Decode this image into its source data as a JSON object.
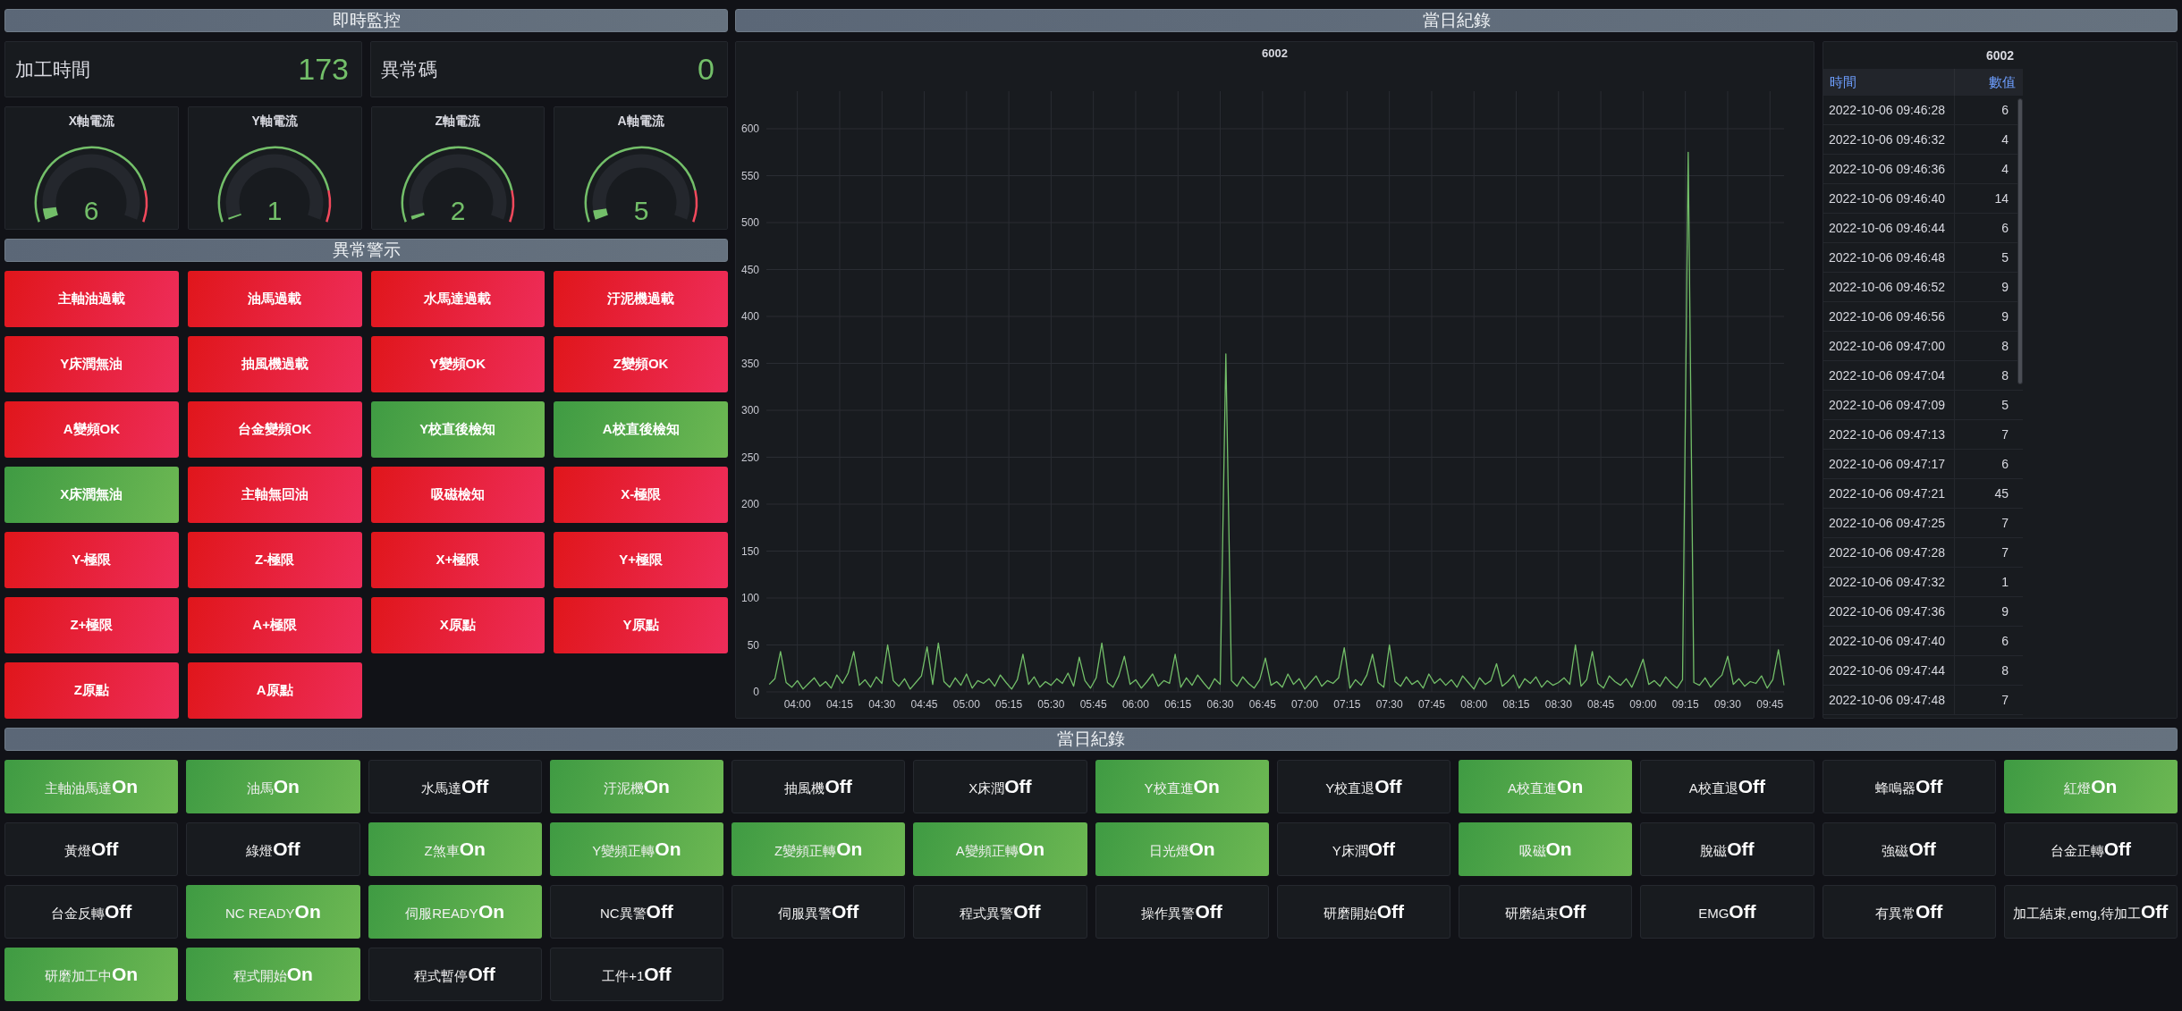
{
  "realtime_header": {
    "title": "即時監控"
  },
  "stat_panels": [
    {
      "label": "加工時間",
      "value": "173"
    },
    {
      "label": "異常碼",
      "value": "0"
    }
  ],
  "gauges": [
    {
      "title": "X軸電流",
      "value": "6",
      "level": 0.06
    },
    {
      "title": "Y軸電流",
      "value": "1",
      "level": 0.01
    },
    {
      "title": "Z軸電流",
      "value": "2",
      "level": 0.02
    },
    {
      "title": "A軸電流",
      "value": "5",
      "level": 0.05
    }
  ],
  "alarm_header": {
    "title": "異常警示"
  },
  "alarms": [
    {
      "label": "主軸油過載",
      "alarm": true
    },
    {
      "label": "油馬過載",
      "alarm": true
    },
    {
      "label": "水馬達過載",
      "alarm": true
    },
    {
      "label": "汙泥機過載",
      "alarm": true
    },
    {
      "label": "Y床潤無油",
      "alarm": true
    },
    {
      "label": "抽風機過載",
      "alarm": true
    },
    {
      "label": "Y變頻OK",
      "alarm": true
    },
    {
      "label": "Z變頻OK",
      "alarm": true
    },
    {
      "label": "A變頻OK",
      "alarm": true
    },
    {
      "label": "台金變頻OK",
      "alarm": true
    },
    {
      "label": "Y校直後檢知",
      "alarm": false
    },
    {
      "label": "A校直後檢知",
      "alarm": false
    },
    {
      "label": "X床潤無油",
      "alarm": false
    },
    {
      "label": "主軸無回油",
      "alarm": true
    },
    {
      "label": "吸磁檢知",
      "alarm": true
    },
    {
      "label": "X-極限",
      "alarm": true
    },
    {
      "label": "Y-極限",
      "alarm": true
    },
    {
      "label": "Z-極限",
      "alarm": true
    },
    {
      "label": "X+極限",
      "alarm": true
    },
    {
      "label": "Y+極限",
      "alarm": true
    },
    {
      "label": "Z+極限",
      "alarm": true
    },
    {
      "label": "A+極限",
      "alarm": true
    },
    {
      "label": "X原點",
      "alarm": true
    },
    {
      "label": "Y原點",
      "alarm": true
    },
    {
      "label": "Z原點",
      "alarm": true
    },
    {
      "label": "A原點",
      "alarm": true
    }
  ],
  "daily_header": {
    "title": "當日紀錄"
  },
  "chart_panel": {
    "chart_data": {
      "type": "line",
      "title": "6002",
      "grid": true,
      "x": [
        230,
        232,
        234,
        236,
        238,
        240,
        242,
        244,
        246,
        248,
        250,
        252,
        254,
        256,
        258,
        260,
        262,
        264,
        266,
        268,
        270,
        272,
        274,
        276,
        278,
        280,
        282,
        284,
        286,
        288,
        290,
        292,
        294,
        296,
        298,
        300,
        302,
        304,
        306,
        308,
        310,
        312,
        314,
        316,
        318,
        320,
        322,
        324,
        326,
        328,
        330,
        332,
        334,
        336,
        338,
        340,
        342,
        344,
        346,
        348,
        350,
        352,
        354,
        356,
        358,
        360,
        362,
        364,
        366,
        368,
        370,
        372,
        374,
        376,
        378,
        380,
        382,
        384,
        386,
        388,
        390,
        392,
        394,
        396,
        398,
        400,
        402,
        404,
        406,
        408,
        410,
        412,
        414,
        416,
        418,
        420,
        422,
        424,
        426,
        428,
        430,
        432,
        434,
        436,
        438,
        440,
        442,
        444,
        446,
        448,
        450,
        452,
        454,
        456,
        458,
        460,
        462,
        464,
        466,
        468,
        470,
        472,
        474,
        476,
        478,
        480,
        482,
        484,
        486,
        488,
        490,
        492,
        494,
        496,
        498,
        500,
        502,
        504,
        506,
        508,
        510,
        512,
        514,
        516,
        518,
        520,
        522,
        524,
        526,
        528,
        530,
        532,
        534,
        536,
        538,
        540,
        542,
        544,
        546,
        548,
        550,
        552,
        554,
        556,
        558,
        560,
        562,
        564,
        566,
        568,
        570,
        572,
        574,
        576,
        578,
        580,
        582,
        584,
        586,
        588,
        590
      ],
      "series": [
        {
          "color": "#73bf69",
          "values": [
            8,
            14,
            43,
            10,
            5,
            12,
            3,
            9,
            15,
            6,
            11,
            4,
            18,
            9,
            20,
            43,
            7,
            13,
            5,
            16,
            9,
            50,
            12,
            6,
            14,
            3,
            10,
            17,
            48,
            8,
            52,
            11,
            5,
            15,
            7,
            19,
            4,
            12,
            9,
            14,
            6,
            18,
            10,
            3,
            13,
            40,
            8,
            16,
            5,
            11,
            7,
            14,
            9,
            20,
            6,
            37,
            12,
            4,
            15,
            52,
            10,
            5,
            17,
            38,
            8,
            13,
            4,
            11,
            19,
            6,
            12,
            9,
            40,
            5,
            15,
            7,
            18,
            10,
            3,
            14,
            8,
            360,
            12,
            6,
            16,
            9,
            4,
            13,
            36,
            7,
            11,
            5,
            19,
            8,
            14,
            3,
            10,
            17,
            6,
            12,
            9,
            15,
            47,
            4,
            13,
            7,
            18,
            40,
            10,
            5,
            50,
            11,
            6,
            16,
            8,
            12,
            4,
            19,
            9,
            14,
            7,
            13,
            5,
            17,
            10,
            3,
            15,
            8,
            12,
            30,
            6,
            11,
            18,
            4,
            14,
            9,
            16,
            5,
            12,
            7,
            10,
            15,
            8,
            50,
            6,
            13,
            43,
            9,
            4,
            17,
            11,
            7,
            14,
            5,
            19,
            35,
            8,
            12,
            6,
            16,
            9,
            4,
            13,
            575,
            10,
            7,
            15,
            5,
            12,
            18,
            38,
            8,
            14,
            6,
            11,
            9,
            17,
            4,
            13,
            45,
            7
          ]
        }
      ],
      "xlim": [
        229,
        590
      ],
      "ylim": [
        0,
        640
      ],
      "xticks": [
        {
          "value": 240,
          "label": "04:00"
        },
        {
          "value": 255,
          "label": "04:15"
        },
        {
          "value": 270,
          "label": "04:30"
        },
        {
          "value": 285,
          "label": "04:45"
        },
        {
          "value": 300,
          "label": "05:00"
        },
        {
          "value": 315,
          "label": "05:15"
        },
        {
          "value": 330,
          "label": "05:30"
        },
        {
          "value": 345,
          "label": "05:45"
        },
        {
          "value": 360,
          "label": "06:00"
        },
        {
          "value": 375,
          "label": "06:15"
        },
        {
          "value": 390,
          "label": "06:30"
        },
        {
          "value": 405,
          "label": "06:45"
        },
        {
          "value": 420,
          "label": "07:00"
        },
        {
          "value": 435,
          "label": "07:15"
        },
        {
          "value": 450,
          "label": "07:30"
        },
        {
          "value": 465,
          "label": "07:45"
        },
        {
          "value": 480,
          "label": "08:00"
        },
        {
          "value": 495,
          "label": "08:15"
        },
        {
          "value": 510,
          "label": "08:30"
        },
        {
          "value": 525,
          "label": "08:45"
        },
        {
          "value": 540,
          "label": "09:00"
        },
        {
          "value": 555,
          "label": "09:15"
        },
        {
          "value": 570,
          "label": "09:30"
        },
        {
          "value": 585,
          "label": "09:45"
        }
      ],
      "yticks": [
        0,
        50,
        100,
        150,
        200,
        250,
        300,
        350,
        400,
        450,
        500,
        550,
        600
      ]
    }
  },
  "table_panel": {
    "title": "6002",
    "columns": [
      "時間",
      "數值"
    ],
    "rows": [
      [
        "2022-10-06 09:46:28",
        "6"
      ],
      [
        "2022-10-06 09:46:32",
        "4"
      ],
      [
        "2022-10-06 09:46:36",
        "4"
      ],
      [
        "2022-10-06 09:46:40",
        "14"
      ],
      [
        "2022-10-06 09:46:44",
        "6"
      ],
      [
        "2022-10-06 09:46:48",
        "5"
      ],
      [
        "2022-10-06 09:46:52",
        "9"
      ],
      [
        "2022-10-06 09:46:56",
        "9"
      ],
      [
        "2022-10-06 09:47:00",
        "8"
      ],
      [
        "2022-10-06 09:47:04",
        "8"
      ],
      [
        "2022-10-06 09:47:09",
        "5"
      ],
      [
        "2022-10-06 09:47:13",
        "7"
      ],
      [
        "2022-10-06 09:47:17",
        "6"
      ],
      [
        "2022-10-06 09:47:21",
        "45"
      ],
      [
        "2022-10-06 09:47:25",
        "7"
      ],
      [
        "2022-10-06 09:47:28",
        "7"
      ],
      [
        "2022-10-06 09:47:32",
        "1"
      ],
      [
        "2022-10-06 09:47:36",
        "9"
      ],
      [
        "2022-10-06 09:47:40",
        "6"
      ],
      [
        "2022-10-06 09:47:44",
        "8"
      ],
      [
        "2022-10-06 09:47:48",
        "7"
      ]
    ]
  },
  "status_header": {
    "title": "當日紀錄"
  },
  "status_tiles": [
    {
      "label": "主軸油馬達",
      "value": "On",
      "on": true
    },
    {
      "label": "油馬",
      "value": "On",
      "on": true
    },
    {
      "label": "水馬達",
      "value": "Off",
      "on": false
    },
    {
      "label": "汙泥機",
      "value": "On",
      "on": true
    },
    {
      "label": "抽風機",
      "value": "Off",
      "on": false
    },
    {
      "label": "X床潤",
      "value": "Off",
      "on": false
    },
    {
      "label": "Y校直進",
      "value": "On",
      "on": true
    },
    {
      "label": "Y校直退",
      "value": "Off",
      "on": false
    },
    {
      "label": "A校直進",
      "value": "On",
      "on": true
    },
    {
      "label": "A校直退",
      "value": "Off",
      "on": false
    },
    {
      "label": "蜂鳴器",
      "value": "Off",
      "on": false
    },
    {
      "label": "紅燈",
      "value": "On",
      "on": true
    },
    {
      "label": "黃燈",
      "value": "Off",
      "on": false
    },
    {
      "label": "綠燈",
      "value": "Off",
      "on": false
    },
    {
      "label": "Z煞車",
      "value": "On",
      "on": true
    },
    {
      "label": "Y變頻正轉",
      "value": "On",
      "on": true
    },
    {
      "label": "Z變頻正轉",
      "value": "On",
      "on": true
    },
    {
      "label": "A變頻正轉",
      "value": "On",
      "on": true
    },
    {
      "label": "日光燈",
      "value": "On",
      "on": true
    },
    {
      "label": "Y床潤",
      "value": "Off",
      "on": false
    },
    {
      "label": "吸磁",
      "value": "On",
      "on": true
    },
    {
      "label": "脫磁",
      "value": "Off",
      "on": false
    },
    {
      "label": "強磁",
      "value": "Off",
      "on": false
    },
    {
      "label": "台金正轉",
      "value": "Off",
      "on": false
    },
    {
      "label": "台金反轉",
      "value": "Off",
      "on": false
    },
    {
      "label": "NC READY",
      "value": "On",
      "on": true
    },
    {
      "label": "伺服READY",
      "value": "On",
      "on": true
    },
    {
      "label": "NC異警",
      "value": "Off",
      "on": false
    },
    {
      "label": "伺服異警",
      "value": "Off",
      "on": false
    },
    {
      "label": "程式異警",
      "value": "Off",
      "on": false
    },
    {
      "label": "操作異警",
      "value": "Off",
      "on": false
    },
    {
      "label": "研磨開始",
      "value": "Off",
      "on": false
    },
    {
      "label": "研磨結束",
      "value": "Off",
      "on": false
    },
    {
      "label": "EMG",
      "value": "Off",
      "on": false
    },
    {
      "label": "有異常",
      "value": "Off",
      "on": false
    },
    {
      "label": "加工結束,emg,待加工",
      "value": "Off",
      "on": false
    },
    {
      "label": "研磨加工中",
      "value": "On",
      "on": true
    },
    {
      "label": "程式開始",
      "value": "On",
      "on": true
    },
    {
      "label": "程式暫停",
      "value": "Off",
      "on": false
    },
    {
      "label": "工件+1",
      "value": "Off",
      "on": false
    }
  ]
}
